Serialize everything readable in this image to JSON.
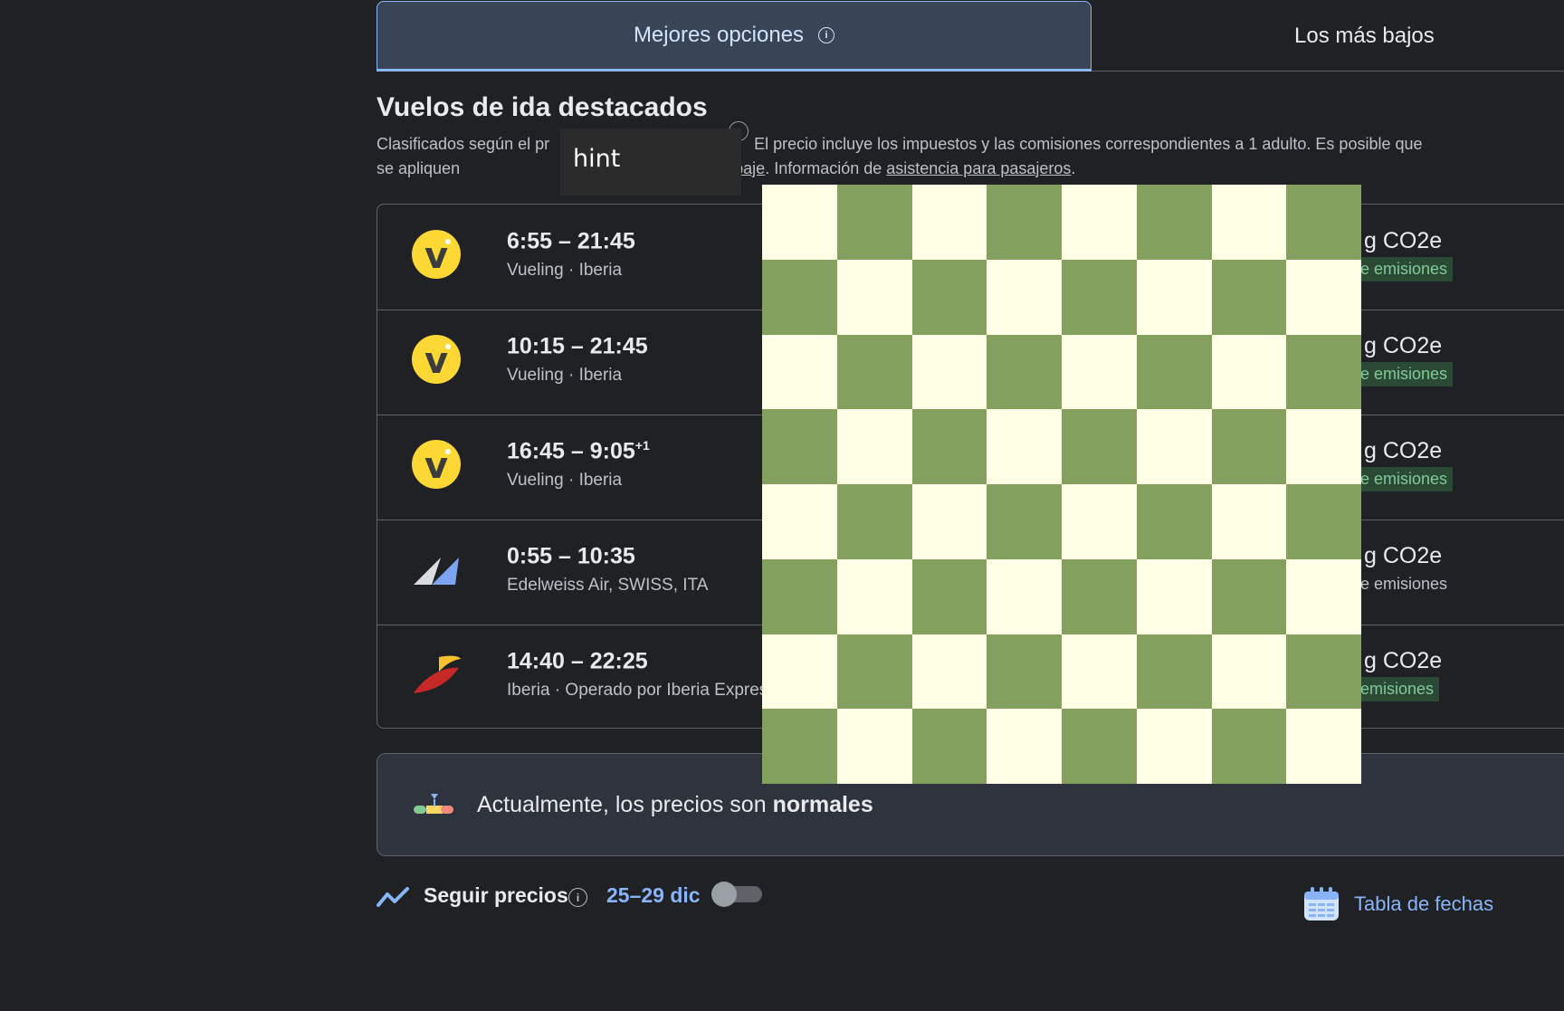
{
  "tabs": {
    "best_label": "Mejores opciones",
    "lowest_label": "Los más bajos"
  },
  "section": {
    "title": "Vuelos de ida destacados",
    "subtitle_part1": "Clasificados según el pr",
    "subtitle_part2": "El precio incluye los impuestos y las comisiones correspondientes a 1 adulto. Es posible que se apliquen",
    "baggage_link": "rifas de equipaje",
    "subtitle_part3": ". Información de ",
    "assistance_link": "asistencia para pasajeros",
    "subtitle_end": "."
  },
  "flights": [
    {
      "times": "6:55 – 21:45",
      "plus": "",
      "airline": "Vueling · Iberia",
      "co2": "CO2e",
      "emissions": "e emisiones",
      "emissions_style": "green",
      "logo": "vueling-logo"
    },
    {
      "times": "10:15 – 21:45",
      "plus": "",
      "airline": "Vueling · Iberia",
      "co2": "CO2e",
      "emissions": "e emisiones",
      "emissions_style": "green",
      "logo": "vueling-logo"
    },
    {
      "times": "16:45 – 9:05",
      "plus": "+1",
      "airline": "Vueling · Iberia",
      "co2": "CO2e",
      "emissions": "e emisiones",
      "emissions_style": "green",
      "logo": "vueling-logo"
    },
    {
      "times": "0:55 – 10:35",
      "plus": "",
      "airline": "Edelweiss Air, SWISS, ITA",
      "co2": "CO2e",
      "emissions": "e emisiones",
      "emissions_style": "plain",
      "logo": "edelweiss-logo"
    },
    {
      "times": "14:40 – 22:25",
      "plus": "",
      "airline": "Iberia · Operado por Iberia Express",
      "co2": "CO2e",
      "emissions": "emisiones",
      "emissions_style": "green",
      "logo": "iberia-logo"
    }
  ],
  "price_insight": {
    "text": "Actualmente, los precios son ",
    "level": "normales"
  },
  "track": {
    "label": "Seguir precios",
    "dates": "25–29 dic",
    "enabled": false
  },
  "calendar": {
    "label": "Tabla de fechas"
  },
  "tooltip": {
    "text": "hint"
  },
  "board": {
    "rows": 8,
    "cols": 8,
    "light_color": "#ffffe6",
    "dark_color": "#84a05f"
  },
  "colors": {
    "background": "#202124",
    "accent": "#8ab4f8",
    "vueling_yellow": "#fdd835"
  }
}
